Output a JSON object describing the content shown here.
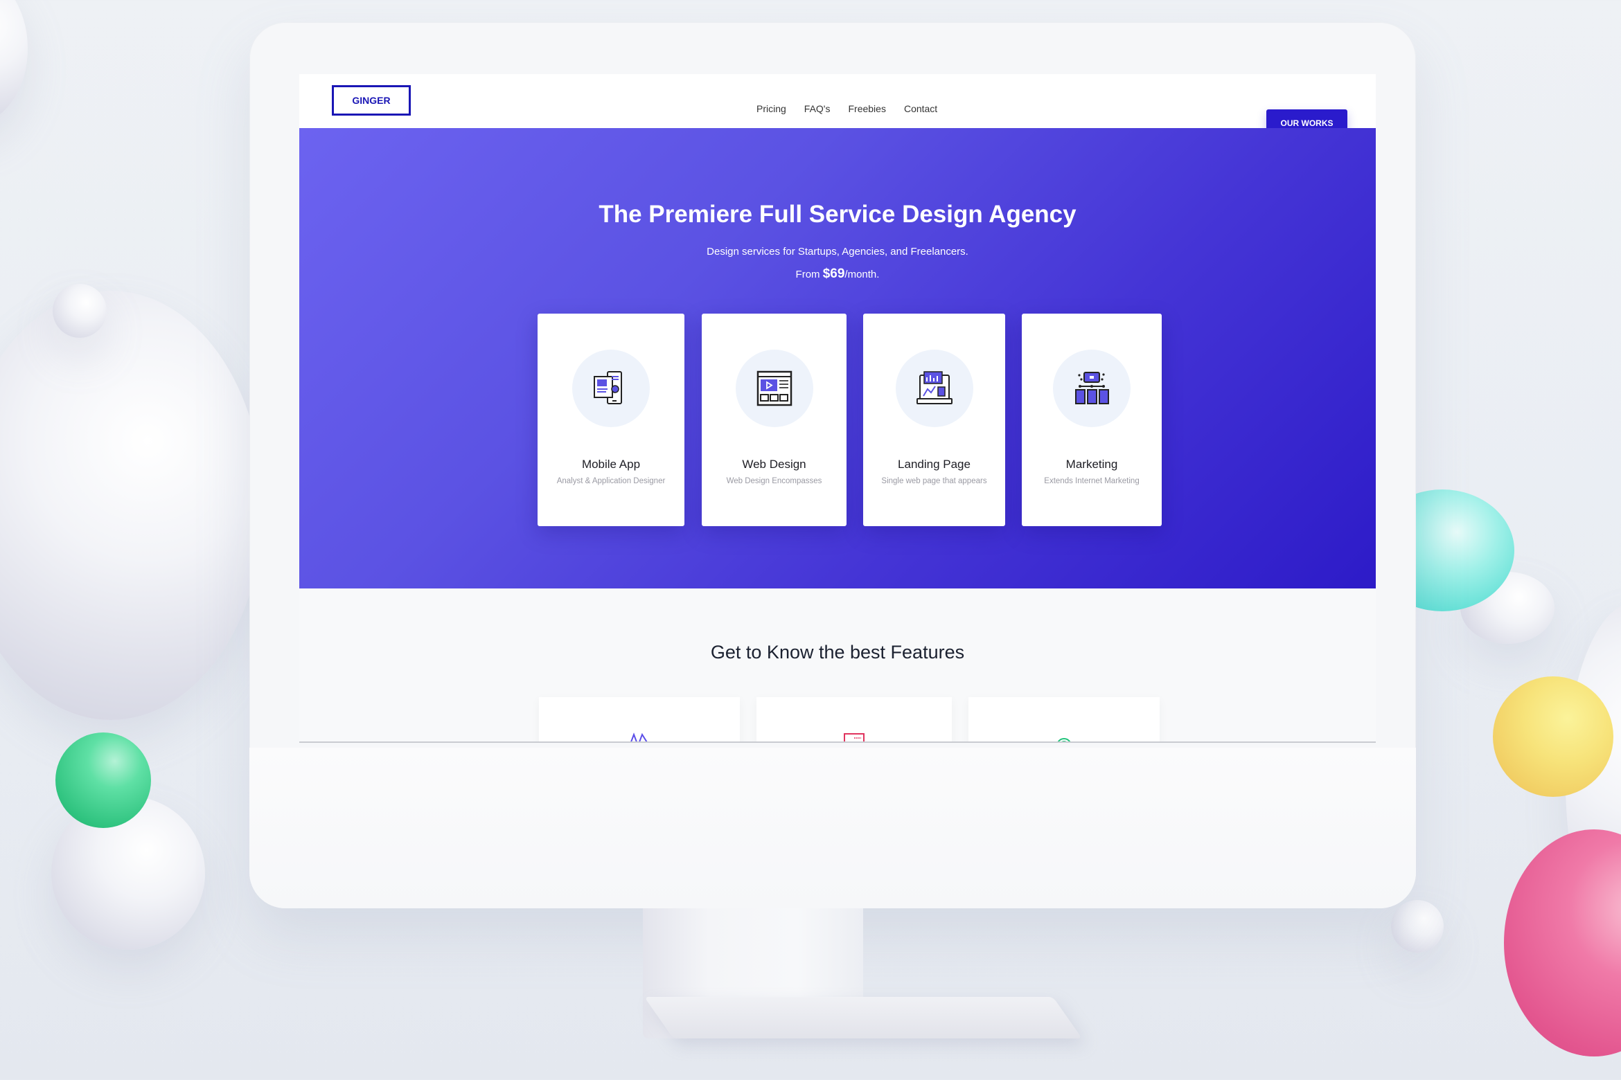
{
  "site": {
    "logo": "GINGER",
    "nav": [
      {
        "label": "Pricing"
      },
      {
        "label": "FAQ's"
      },
      {
        "label": "Freebies"
      },
      {
        "label": "Contact"
      }
    ],
    "cta_label": "OUR WORKS",
    "brand_color": "#2a1bcc"
  },
  "hero": {
    "title": "The Premiere Full Service Design Agency",
    "subtitle": "Design services for Startups, Agencies, and Freelancers.",
    "price_prefix": "From ",
    "price_amount": "$69",
    "price_suffix": "/month.",
    "gradient": [
      "#6c63f0",
      "#2d1bc8"
    ]
  },
  "services": [
    {
      "title": "Mobile App",
      "subtitle": "Analyst & Application Designer",
      "icon": "mobile-app-icon"
    },
    {
      "title": "Web Design",
      "subtitle": "Web Design Encompasses",
      "icon": "web-design-icon"
    },
    {
      "title": "Landing Page",
      "subtitle": "Single web page that appears",
      "icon": "landing-page-icon"
    },
    {
      "title": "Marketing",
      "subtitle": "Extends Internet Marketing",
      "icon": "marketing-icon"
    }
  ],
  "features": {
    "title": "Get to Know the best Features",
    "cards": [
      {
        "icon": "vector-pen-icon",
        "color": "#5b4ee8"
      },
      {
        "icon": "browser-window-icon",
        "color": "#e0345e"
      },
      {
        "icon": "signal-arc-icon",
        "color": "#1fc37a"
      }
    ]
  }
}
